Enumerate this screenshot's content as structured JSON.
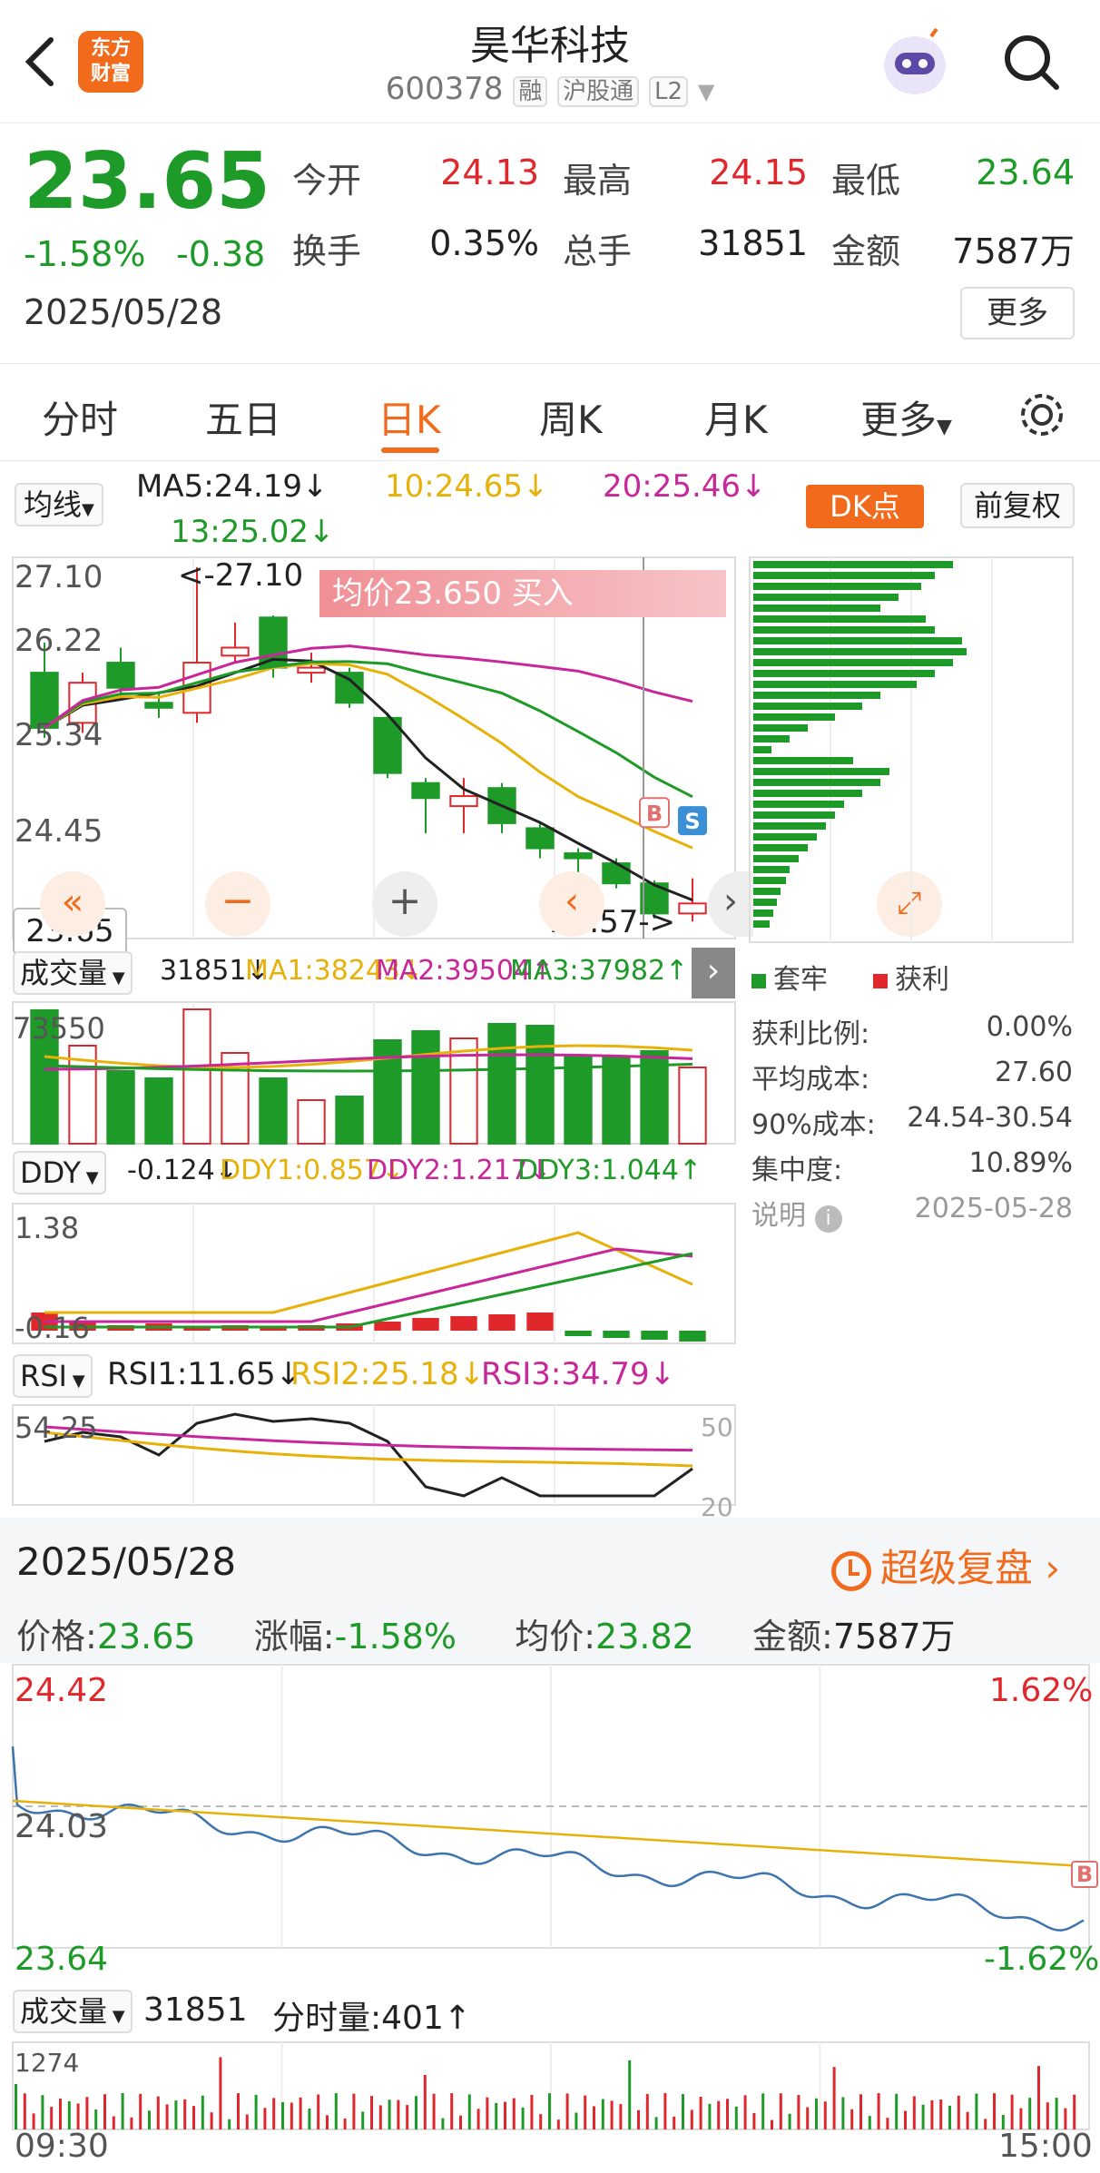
{
  "header": {
    "logo_text": "东方财富",
    "title": "昊华科技",
    "code": "600378",
    "tags": [
      "融",
      "沪股通",
      "L2"
    ]
  },
  "quote": {
    "price": "23.65",
    "change_pct": "-1.58%",
    "change": "-0.38",
    "date": "2025/05/28",
    "open_label": "今开",
    "open": "24.13",
    "high_label": "最高",
    "high": "24.15",
    "low_label": "最低",
    "low": "23.64",
    "turnover_label": "换手",
    "turnover": "0.35%",
    "volume_label": "总手",
    "volume": "31851",
    "amount_label": "金额",
    "amount": "7587万",
    "more_button": "更多"
  },
  "tabs": [
    "分时",
    "五日",
    "日K",
    "周K",
    "月K",
    "更多"
  ],
  "active_tab": "日K",
  "kline": {
    "ma_selector": "均线",
    "ma5": "MA5:24.19↓",
    "ma10": "10:24.65↓",
    "ma20": "20:25.46↓",
    "ma13": "13:25.02↓",
    "dk_button": "DK点",
    "adjust_button": "前复权",
    "y_labels": [
      "27.10",
      "26.22",
      "25.34",
      "24.45"
    ],
    "max_label": "<-27.10",
    "min_label": "23.57->",
    "current_price_label": "23.65",
    "banner_text": "均价23.650 买入",
    "buy_marker": "B",
    "sell_marker": "S",
    "candles": [
      {
        "o": 26.05,
        "c": 25.5,
        "h": 26.35,
        "l": 25.4
      },
      {
        "o": 25.55,
        "c": 25.95,
        "h": 26.05,
        "l": 25.45
      },
      {
        "o": 26.15,
        "c": 25.9,
        "h": 26.3,
        "l": 25.8
      },
      {
        "o": 25.75,
        "c": 25.7,
        "h": 25.85,
        "l": 25.6
      },
      {
        "o": 25.65,
        "c": 26.15,
        "h": 27.1,
        "l": 25.55
      },
      {
        "o": 26.22,
        "c": 26.3,
        "h": 26.55,
        "l": 26.15
      },
      {
        "o": 26.6,
        "c": 26.1,
        "h": 26.62,
        "l": 26.0
      },
      {
        "o": 26.05,
        "c": 26.1,
        "h": 26.25,
        "l": 25.95
      },
      {
        "o": 26.05,
        "c": 25.75,
        "h": 26.1,
        "l": 25.7
      },
      {
        "o": 25.6,
        "c": 25.05,
        "h": 25.65,
        "l": 25.0
      },
      {
        "o": 24.95,
        "c": 24.8,
        "h": 25.0,
        "l": 24.45
      },
      {
        "o": 24.72,
        "c": 24.82,
        "h": 25.0,
        "l": 24.45
      },
      {
        "o": 24.9,
        "c": 24.55,
        "h": 24.95,
        "l": 24.45
      },
      {
        "o": 24.5,
        "c": 24.3,
        "h": 24.55,
        "l": 24.2
      },
      {
        "o": 24.25,
        "c": 24.2,
        "h": 24.3,
        "l": 24.05
      },
      {
        "o": 24.15,
        "c": 23.95,
        "h": 24.2,
        "l": 23.9
      },
      {
        "o": 23.95,
        "c": 23.65,
        "h": 23.98,
        "l": 23.6
      },
      {
        "o": 23.65,
        "c": 23.75,
        "h": 24.0,
        "l": 23.57
      }
    ],
    "volume_selector": "成交量",
    "volume_value": "31851↓",
    "vol_ma1": "MA1:38243↓",
    "vol_ma2": "MA2:39504↑",
    "vol_ma3": "MA3:37982↑",
    "volume_top_label": "73550",
    "volumes": [
      73550,
      54000,
      40000,
      36000,
      74000,
      50000,
      36000,
      24000,
      26000,
      57000,
      62000,
      58000,
      66000,
      65000,
      48000,
      48000,
      51000,
      42000
    ],
    "ddy_selector": "DDY",
    "ddy_value": "-0.124↓",
    "ddy1": "DDY1:0.857↓",
    "ddy2": "DDY2:1.217↓",
    "ddy3": "DDY3:1.044↑",
    "ddy_top_label": "1.38",
    "ddy_bottom_label": "-0.16",
    "rsi_selector": "RSI",
    "rsi1": "RSI1:11.65↓",
    "rsi2": "RSI2:25.18↓",
    "rsi3": "RSI3:34.79↓",
    "rsi_top_label": "54.25",
    "rsi_right_label": "50",
    "rsi_right_label2": "20"
  },
  "chip": {
    "legend_hold": "套牢",
    "legend_profit": "获利",
    "rows": [
      {
        "label": "获利比例:",
        "value": "0.00%"
      },
      {
        "label": "平均成本:",
        "value": "27.60"
      },
      {
        "label": "90%成本:",
        "value": "24.54-30.54"
      },
      {
        "label": "集中度:",
        "value": "10.89%"
      }
    ],
    "note_label": "说明",
    "note_date": "2025-05-28"
  },
  "replay": {
    "date": "2025/05/28",
    "link": "超级复盘",
    "price_label": "价格:",
    "price": "23.65",
    "change_label": "涨幅:",
    "change": "-1.58%",
    "avg_label": "均价:",
    "avg": "23.82",
    "amount_label": "金额:",
    "amount": "7587万"
  },
  "intraday": {
    "top_price": "24.42",
    "mid_price": "24.03",
    "bottom_price": "23.64",
    "top_pct": "1.62%",
    "bottom_pct": "-1.62%",
    "volume_selector": "成交量",
    "volume": "31851",
    "fenshi_label": "分时量:401↑",
    "vol_top_label": "1274",
    "time_start": "09:30",
    "time_end": "15:00",
    "buy_marker": "B"
  },
  "colors": {
    "up": "#e0282c",
    "down": "#1e9a28",
    "accent": "#f26b1c",
    "ma5": "#222222",
    "ma10": "#e8b10a",
    "ma20": "#c8279a",
    "ma13": "#1e9a28"
  }
}
